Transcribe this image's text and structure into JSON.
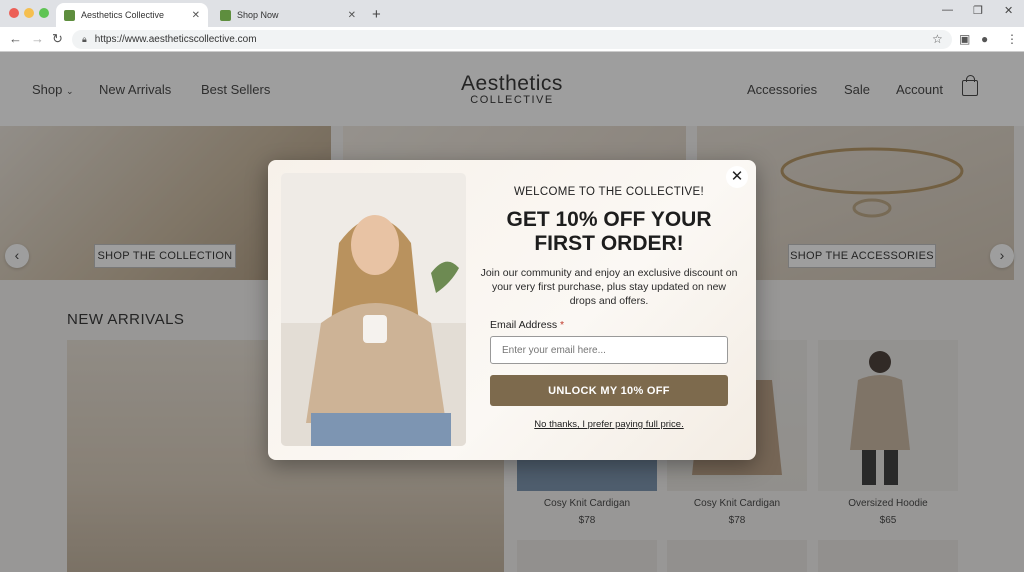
{
  "browser": {
    "tabs": [
      {
        "title": "Aesthetics Collective",
        "active": true
      },
      {
        "title": "Shop Now",
        "active": false
      }
    ],
    "url": "https://www.aestheticscollective.com"
  },
  "header": {
    "logo_line1": "Aesthetics",
    "logo_line2": "COLLECTIVE",
    "nav_left": [
      "Shop",
      "New Arrivals",
      "Best Sellers"
    ],
    "nav_right": [
      "Accessories",
      "Sale",
      "Account"
    ]
  },
  "hero": {
    "left_button": "SHOP THE COLLECTION",
    "right_button": "SHOP THE ACCESSORIES"
  },
  "new_arrivals": {
    "title": "NEW ARRIVALS",
    "products": [
      {
        "name": "Cosy Knit Cardigan",
        "price": "$78"
      },
      {
        "name": "Cosy Knit Cardigan",
        "price": "$78"
      },
      {
        "name": "Oversized Hoodie",
        "price": "$65"
      }
    ]
  },
  "popup": {
    "welcome": "WELCOME TO THE COLLECTIVE!",
    "headline_line1": "GET 10% OFF YOUR",
    "headline_line2": "FIRST ORDER!",
    "subtext": "Join our community and enjoy an exclusive discount on your very first purchase, plus stay updated on new drops and offers.",
    "email_label": "Email Address",
    "required_mark": "*",
    "email_placeholder": "Enter your email here...",
    "cta": "UNLOCK MY 10% OFF",
    "decline": "No thanks, I prefer paying full price."
  },
  "colors": {
    "cta": "#7d6a4d",
    "overlay": "rgba(40,40,40,.45)",
    "required": "#c0392b"
  }
}
